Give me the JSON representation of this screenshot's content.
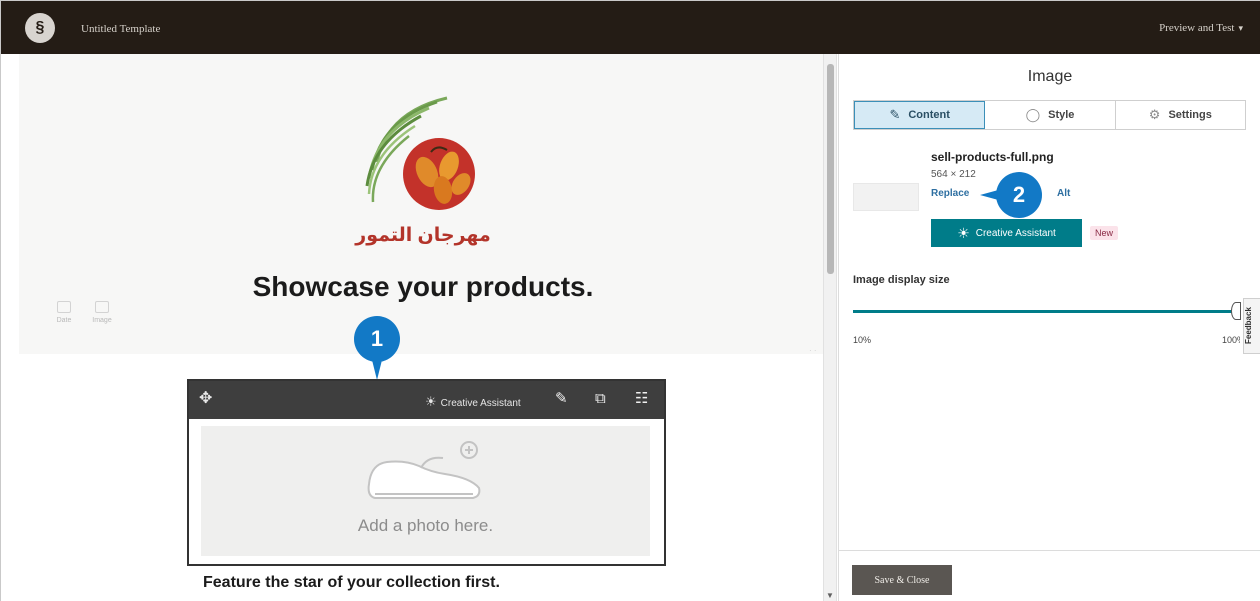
{
  "topbar": {
    "logo_glyph": "§",
    "title": "Untitled Template",
    "preview_label": "Preview and Test",
    "preview_chevron": "▾"
  },
  "canvas": {
    "brand_arabic": "مهرجان التمور",
    "headline": "Showcase your products.",
    "side_tools": [
      {
        "label": "Date"
      },
      {
        "label": "Image"
      }
    ],
    "hero_dots": "· ·",
    "block": {
      "move_glyph": "✥",
      "assistant_glyph": "☀",
      "assistant_label": "Creative Assistant",
      "edit_glyph": "✎",
      "duplicate_glyph": "⧉",
      "delete_glyph": "☷",
      "placeholder_text": "Add a photo here."
    },
    "caption": "Feature the star of your collection first."
  },
  "callouts": [
    "1",
    "2"
  ],
  "scrollbar": {
    "down_glyph": "▼"
  },
  "panel": {
    "title": "Image",
    "tabs": [
      {
        "label": "Content",
        "glyph": "✎",
        "active": true
      },
      {
        "label": "Style",
        "glyph": "◯",
        "active": false
      },
      {
        "label": "Settings",
        "glyph": "⚙",
        "active": false
      }
    ],
    "file": {
      "name": "sell-products-full.png",
      "dimensions": "564 × 212",
      "replace_label": "Replace",
      "alt_label": "Alt"
    },
    "assistant_button": {
      "glyph": "☀",
      "label": "Creative Assistant"
    },
    "new_badge": "New",
    "display_size": {
      "label": "Image display size",
      "min_label": "10%",
      "max_label": "100%",
      "value_percent": 100
    },
    "feedback_label": "Feedback",
    "save_label": "Save & Close"
  },
  "colors": {
    "topbar_bg": "#241c15",
    "accent_teal": "#007c89",
    "callout_blue": "#1279c6",
    "brand_red": "#b3342a"
  }
}
